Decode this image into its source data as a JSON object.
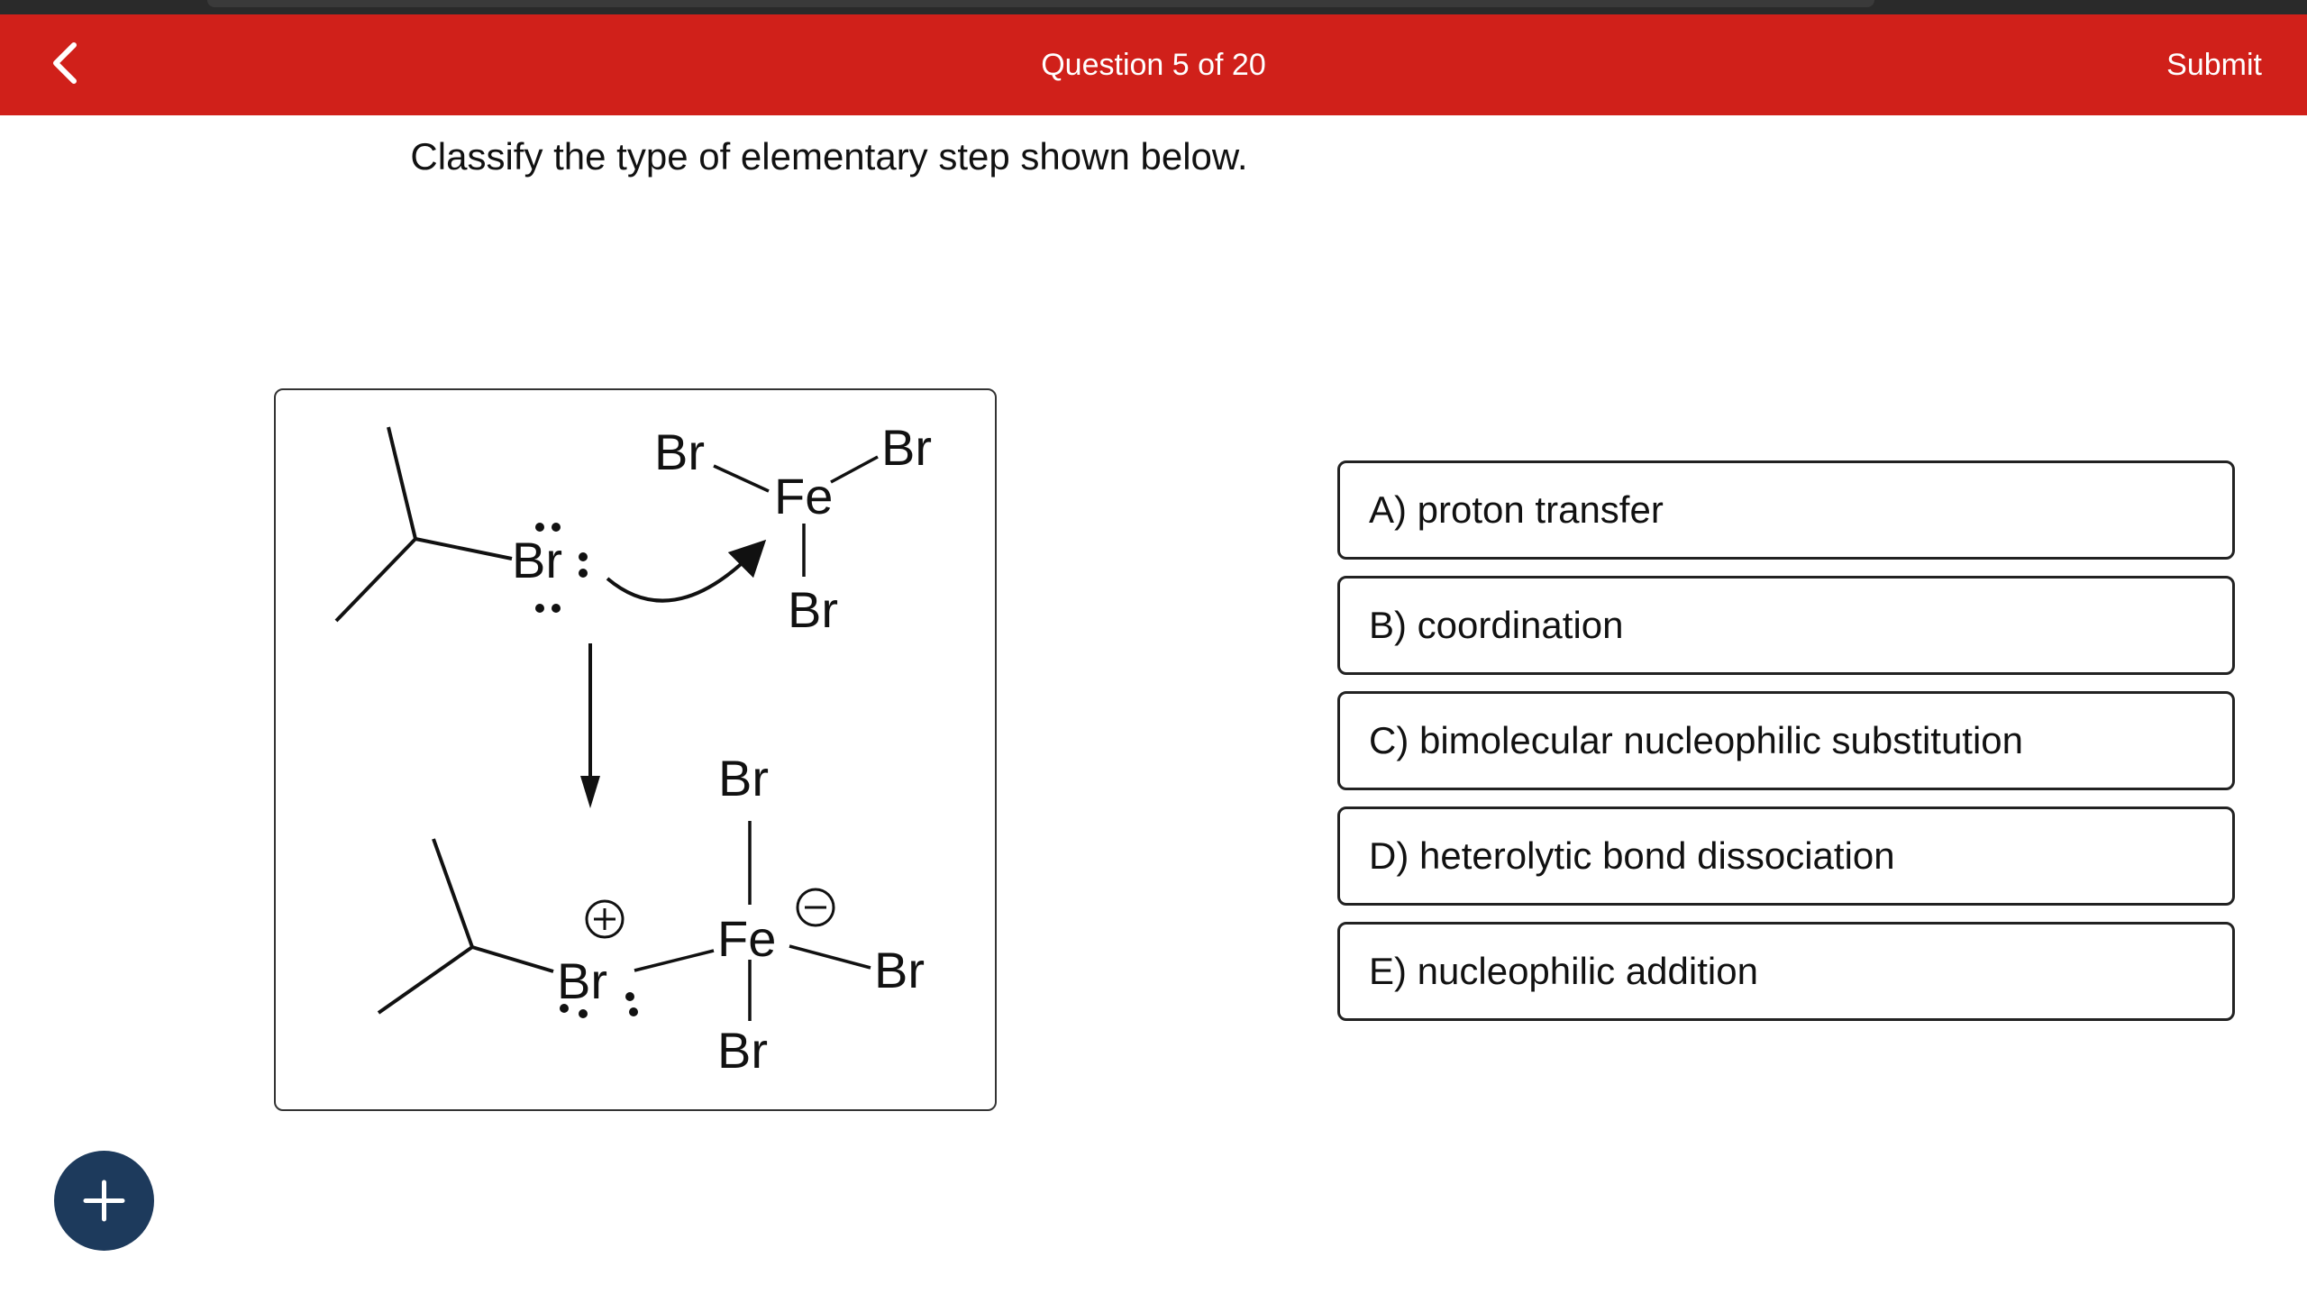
{
  "header": {
    "title": "Question 5 of 20",
    "submit_label": "Submit",
    "accent_color": "#d0201a"
  },
  "question": {
    "prompt": "Classify the type of elementary step shown below."
  },
  "reaction": {
    "top_labels": {
      "br_nucleophile": "Br",
      "fe": "Fe",
      "br_left": "Br",
      "br_right": "Br",
      "br_bottom": "Br"
    },
    "bottom_labels": {
      "br_bridge": "Br",
      "fe": "Fe",
      "br_top": "Br",
      "br_right": "Br",
      "br_bottom": "Br"
    }
  },
  "options": [
    {
      "label": "A) proton transfer"
    },
    {
      "label": "B) coordination"
    },
    {
      "label": "C) bimolecular nucleophilic substitution"
    },
    {
      "label": "D) heterolytic bond dissociation"
    },
    {
      "label": "E) nucleophilic addition"
    }
  ],
  "icons": {
    "back": "chevron-left-icon",
    "add": "plus-icon"
  }
}
